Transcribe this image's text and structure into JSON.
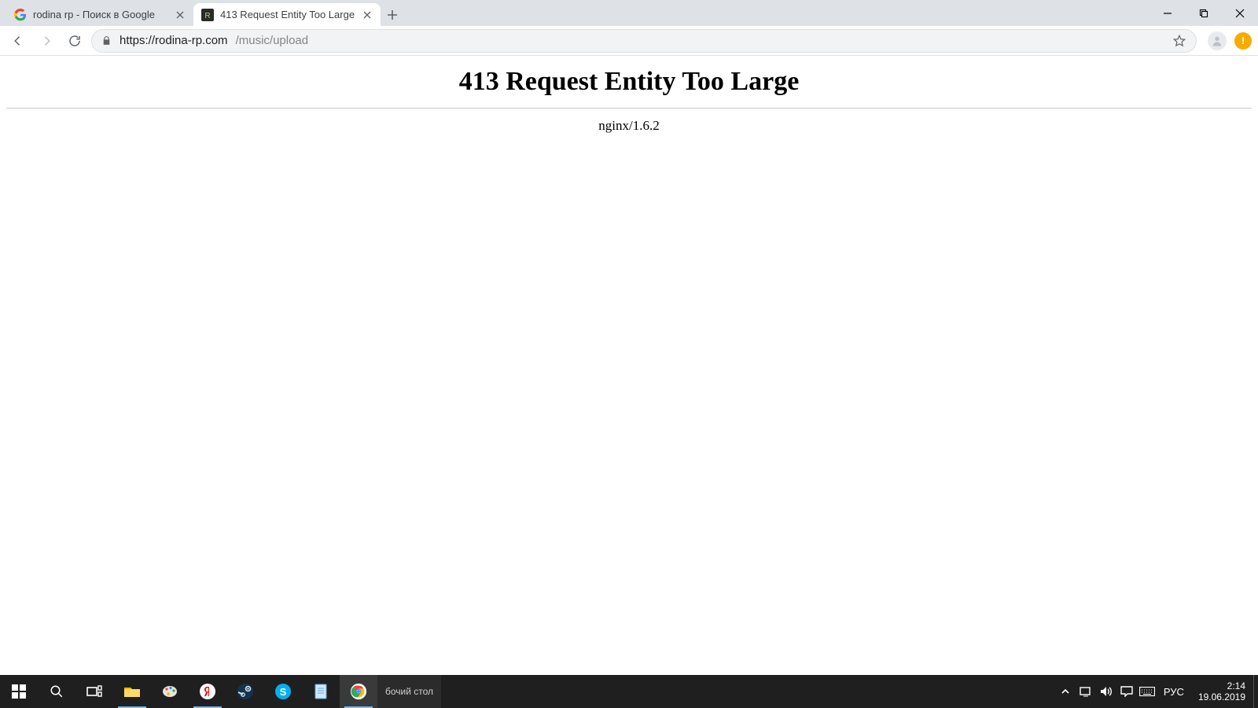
{
  "browser": {
    "tabs": [
      {
        "title": "rodina rp - Поиск в Google",
        "active": false,
        "favicon": "google"
      },
      {
        "title": "413 Request Entity Too Large",
        "active": true,
        "favicon": "site"
      }
    ],
    "url_host": "https://rodina-rp.com",
    "url_path": "/music/upload"
  },
  "page": {
    "heading": "413 Request Entity Too Large",
    "server": "nginx/1.6.2"
  },
  "taskbar": {
    "desktop_peek": "бочий стол",
    "language": "РУС",
    "time": "2:14",
    "date": "19.06.2019"
  }
}
